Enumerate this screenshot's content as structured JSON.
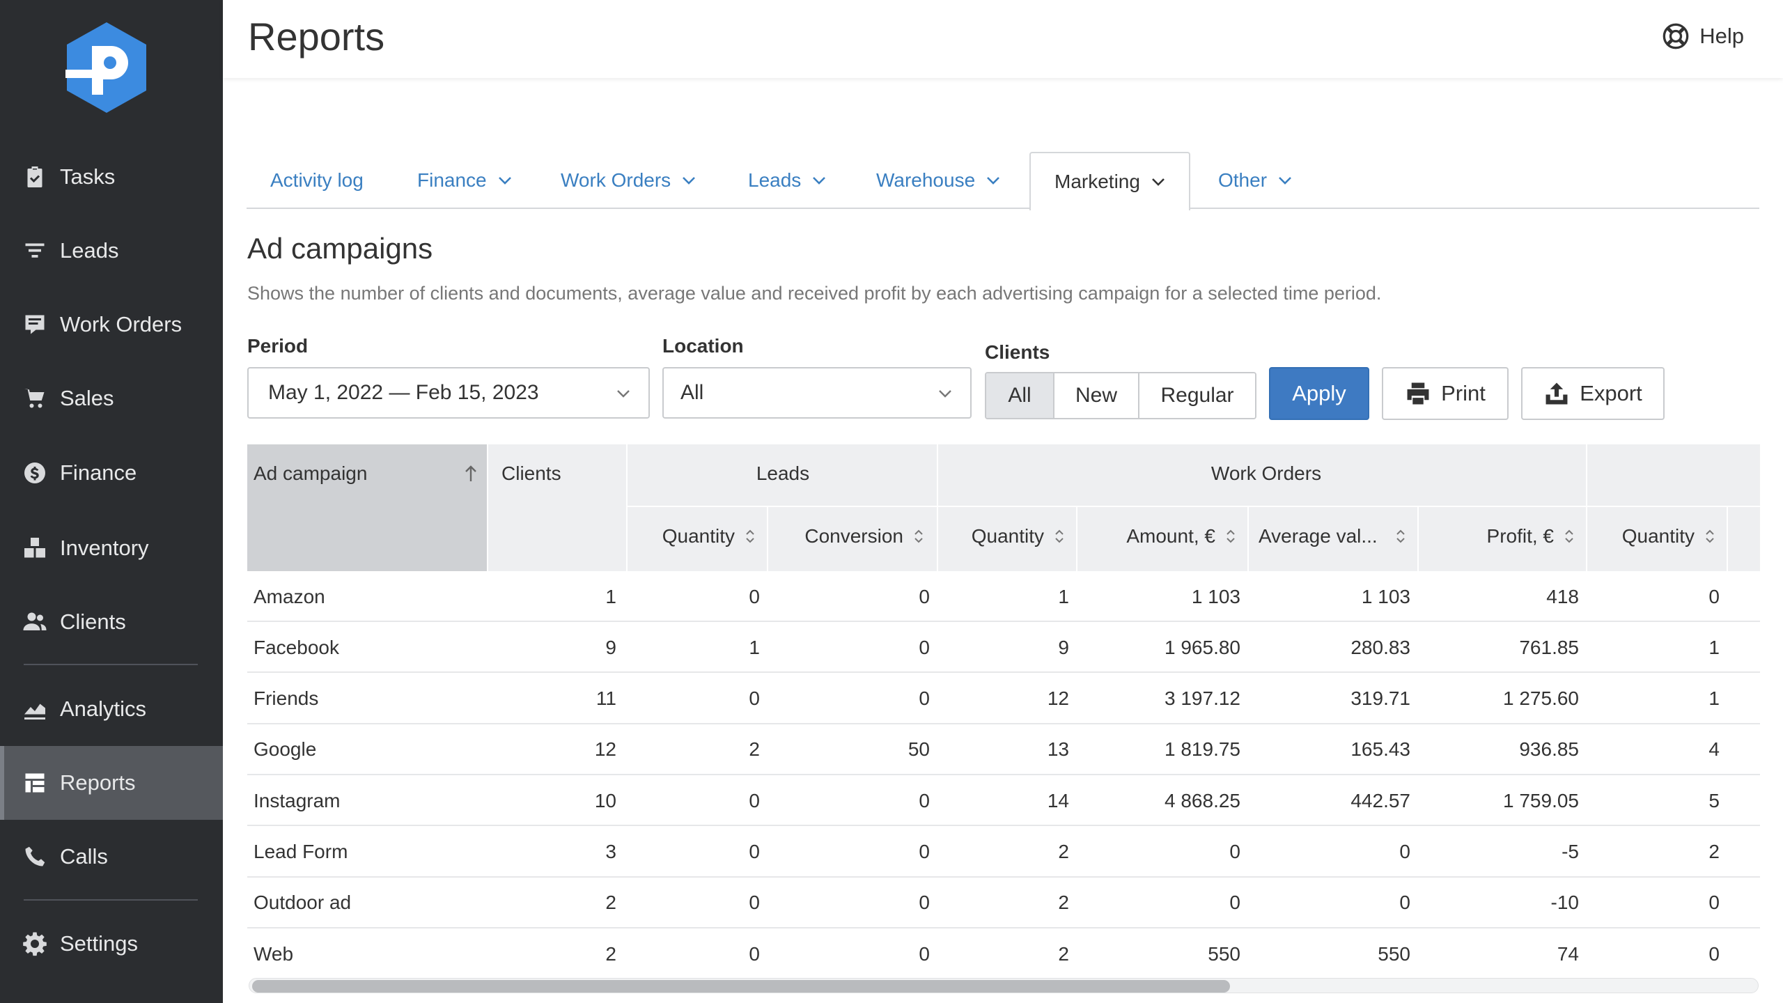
{
  "sidebar": {
    "items": [
      {
        "label": "Tasks",
        "icon": "clipboard-icon"
      },
      {
        "label": "Leads",
        "icon": "funnel-icon"
      },
      {
        "label": "Work Orders",
        "icon": "work-orders-icon"
      },
      {
        "label": "Sales",
        "icon": "cart-icon"
      },
      {
        "label": "Finance",
        "icon": "dollar-icon"
      },
      {
        "label": "Inventory",
        "icon": "boxes-icon"
      },
      {
        "label": "Clients",
        "icon": "people-icon"
      },
      {
        "label": "Analytics",
        "icon": "chart-icon"
      },
      {
        "label": "Reports",
        "icon": "reports-icon",
        "active": true
      },
      {
        "label": "Calls",
        "icon": "phone-icon"
      },
      {
        "label": "Settings",
        "icon": "gear-icon"
      }
    ]
  },
  "header": {
    "title": "Reports",
    "help": "Help"
  },
  "tabs": [
    {
      "label": "Activity log",
      "dropdown": false
    },
    {
      "label": "Finance",
      "dropdown": true
    },
    {
      "label": "Work Orders",
      "dropdown": true
    },
    {
      "label": "Leads",
      "dropdown": true
    },
    {
      "label": "Warehouse",
      "dropdown": true
    },
    {
      "label": "Marketing",
      "dropdown": true,
      "active": true
    },
    {
      "label": "Other",
      "dropdown": true
    }
  ],
  "report": {
    "title": "Ad campaigns",
    "description": "Shows the number of clients and documents, average value and received profit by each advertising campaign for a selected time period."
  },
  "filters": {
    "period_label": "Period",
    "period_value": "May 1, 2022 — Feb 15, 2023",
    "location_label": "Location",
    "location_value": "All",
    "clients_label": "Clients",
    "clients_options": [
      "All",
      "New",
      "Regular"
    ],
    "clients_selected": "All"
  },
  "actions": {
    "apply": "Apply",
    "print": "Print",
    "export": "Export"
  },
  "table": {
    "group_headers": {
      "leads": "Leads",
      "work_orders": "Work Orders"
    },
    "columns": {
      "ad_campaign": "Ad campaign",
      "clients": "Clients",
      "leads_quantity": "Quantity",
      "leads_conversion": "Conversion",
      "wo_quantity": "Quantity",
      "wo_amount": "Amount, €",
      "wo_average": "Average val...",
      "wo_profit": "Profit, €",
      "extra_quantity": "Quantity"
    },
    "rows": [
      {
        "campaign": "Amazon",
        "clients": "1",
        "leads_qty": "0",
        "conversion": "0",
        "wo_qty": "1",
        "amount": "1 103",
        "average": "1 103",
        "profit": "418",
        "qty2": "0"
      },
      {
        "campaign": "Facebook",
        "clients": "9",
        "leads_qty": "1",
        "conversion": "0",
        "wo_qty": "9",
        "amount": "1 965.80",
        "average": "280.83",
        "profit": "761.85",
        "qty2": "1"
      },
      {
        "campaign": "Friends",
        "clients": "11",
        "leads_qty": "0",
        "conversion": "0",
        "wo_qty": "12",
        "amount": "3 197.12",
        "average": "319.71",
        "profit": "1 275.60",
        "qty2": "1"
      },
      {
        "campaign": "Google",
        "clients": "12",
        "leads_qty": "2",
        "conversion": "50",
        "wo_qty": "13",
        "amount": "1 819.75",
        "average": "165.43",
        "profit": "936.85",
        "qty2": "4"
      },
      {
        "campaign": "Instagram",
        "clients": "10",
        "leads_qty": "0",
        "conversion": "0",
        "wo_qty": "14",
        "amount": "4 868.25",
        "average": "442.57",
        "profit": "1 759.05",
        "qty2": "5"
      },
      {
        "campaign": "Lead Form",
        "clients": "3",
        "leads_qty": "0",
        "conversion": "0",
        "wo_qty": "2",
        "amount": "0",
        "average": "0",
        "profit": "-5",
        "qty2": "2"
      },
      {
        "campaign": "Outdoor ad",
        "clients": "2",
        "leads_qty": "0",
        "conversion": "0",
        "wo_qty": "2",
        "amount": "0",
        "average": "0",
        "profit": "-10",
        "qty2": "0"
      },
      {
        "campaign": "Web",
        "clients": "2",
        "leads_qty": "0",
        "conversion": "0",
        "wo_qty": "2",
        "amount": "550",
        "average": "550",
        "profit": "74",
        "qty2": "0"
      }
    ]
  },
  "colors": {
    "sidebar_bg": "#2b2d30",
    "accent": "#3e7ac2",
    "link": "#3a7fc1"
  }
}
